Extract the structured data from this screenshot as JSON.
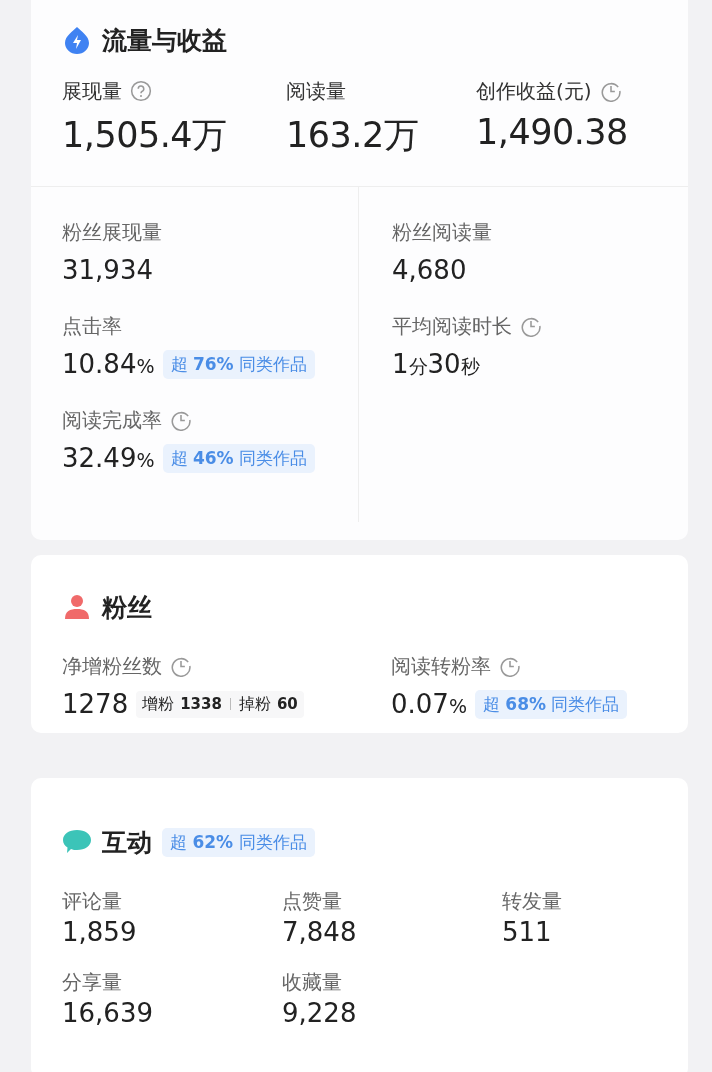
{
  "traffic": {
    "title": "流量与收益",
    "top": [
      {
        "label": "展现量",
        "kind": "help",
        "value": "1,505.4",
        "unit": "万"
      },
      {
        "label": "阅读量",
        "kind": "plain",
        "value": "163.2",
        "unit": "万"
      },
      {
        "label": "创作收益(元)",
        "kind": "clock",
        "value": "1,490.38"
      }
    ],
    "left": [
      {
        "label": "粉丝展现量",
        "kind": "plain",
        "parts": [
          {
            "t": "31,934",
            "kind": "num"
          }
        ]
      },
      {
        "label": "点击率",
        "kind": "plain",
        "parts": [
          {
            "t": "10.84",
            "kind": "num"
          },
          {
            "t": "%",
            "kind": "unit"
          }
        ],
        "badge": "超 **76%** 同类作品"
      },
      {
        "label": "阅读完成率",
        "kind": "clock",
        "parts": [
          {
            "t": "32.49",
            "kind": "num"
          },
          {
            "t": "%",
            "kind": "unit"
          }
        ],
        "badge": "超 **46%** 同类作品"
      }
    ],
    "right": [
      {
        "label": "粉丝阅读量",
        "kind": "plain",
        "parts": [
          {
            "t": "4,680",
            "kind": "num"
          }
        ]
      },
      {
        "label": "平均阅读时长",
        "kind": "clock",
        "parts": [
          {
            "t": "1",
            "kind": "num"
          },
          {
            "t": "分",
            "kind": "unit"
          },
          {
            "t": "30",
            "kind": "num"
          },
          {
            "t": "秒",
            "kind": "unit"
          }
        ]
      }
    ]
  },
  "fans": {
    "title": "粉丝",
    "net": {
      "label": "净增粉丝数",
      "kind": "clock",
      "value": "1278",
      "gain_label": "增粉",
      "gain": "1338",
      "loss_label": "掉粉",
      "loss": "60"
    },
    "conversion": {
      "label": "阅读转粉率",
      "kind": "clock",
      "parts": [
        {
          "t": "0.07",
          "kind": "num"
        },
        {
          "t": "%",
          "kind": "unit"
        }
      ],
      "badge": "超 **68%** 同类作品"
    }
  },
  "interaction": {
    "title": "互动",
    "badge": "超 **62%** 同类作品",
    "metrics": [
      {
        "label": "评论量",
        "value": "1,859"
      },
      {
        "label": "点赞量",
        "value": "7,848"
      },
      {
        "label": "转发量",
        "value": "511"
      },
      {
        "label": "分享量",
        "value": "16,639"
      },
      {
        "label": "收藏量",
        "value": "9,228"
      }
    ]
  }
}
